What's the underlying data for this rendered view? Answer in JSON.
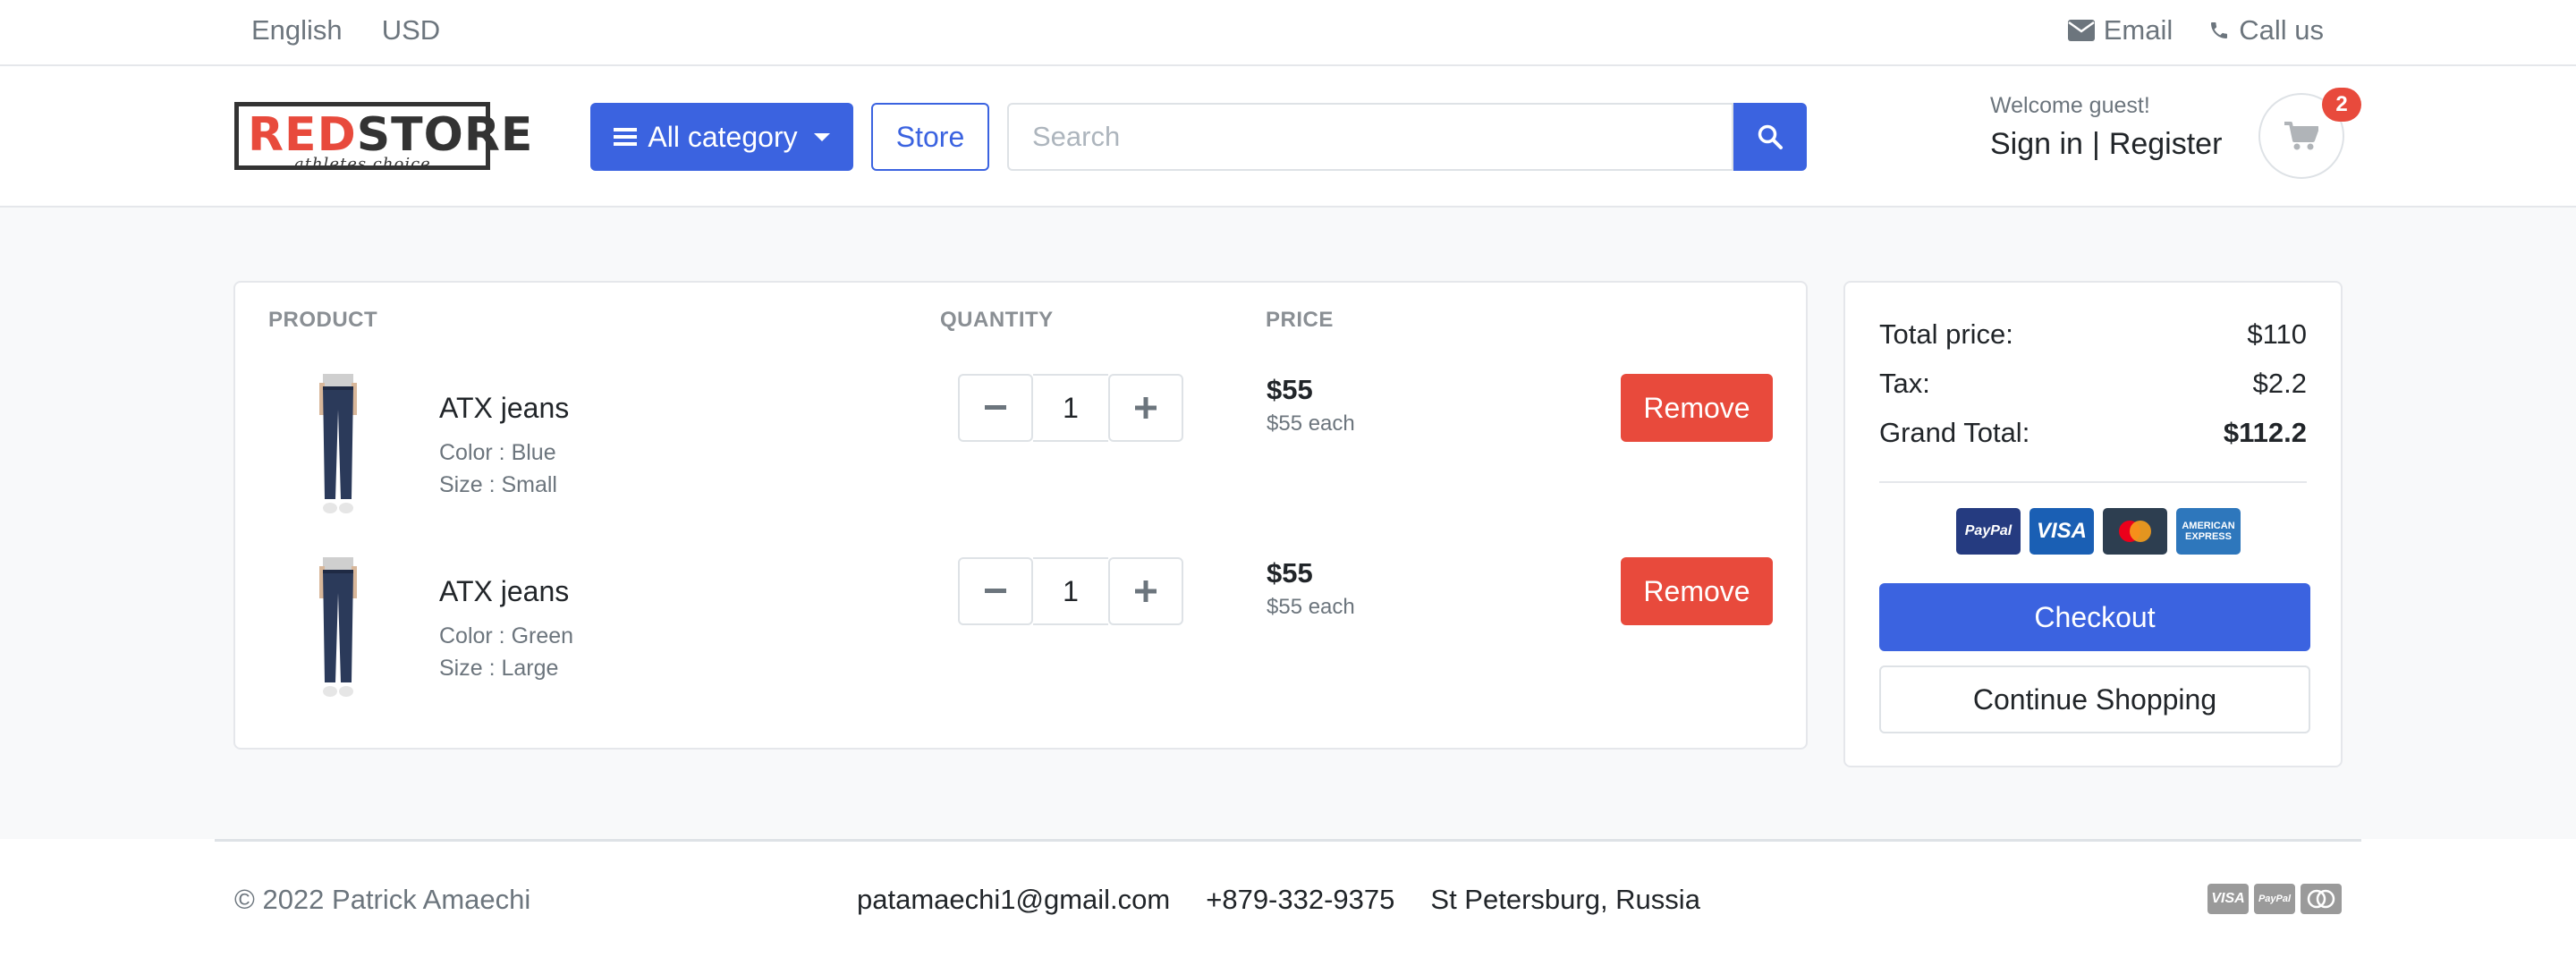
{
  "topbar": {
    "language": "English",
    "currency": "USD",
    "email_label": "Email",
    "call_label": "Call us"
  },
  "header": {
    "logo_part1": "RED",
    "logo_part2": "STORE",
    "logo_tagline": "athletes choice",
    "category_button": "All category",
    "store_button": "Store",
    "search_placeholder": "Search",
    "welcome": "Welcome guest!",
    "sign_in": "Sign in",
    "separator": "|",
    "register": "Register",
    "cart_count": "2"
  },
  "cart": {
    "columns": {
      "product": "PRODUCT",
      "quantity": "QUANTITY",
      "price": "PRICE"
    },
    "items": [
      {
        "name": "ATX jeans",
        "color": "Color : Blue",
        "size": "Size : Small",
        "qty": "1",
        "price": "$55",
        "each": "$55 each",
        "remove": "Remove"
      },
      {
        "name": "ATX jeans",
        "color": "Color : Green",
        "size": "Size : Large",
        "qty": "1",
        "price": "$55",
        "each": "$55 each",
        "remove": "Remove"
      }
    ]
  },
  "summary": {
    "total_label": "Total price:",
    "total_value": "$110",
    "tax_label": "Tax:",
    "tax_value": "$2.2",
    "grand_label": "Grand Total:",
    "grand_value": "$112.2",
    "payment_icons": [
      "PayPal",
      "VISA",
      "mastercard",
      "AMERICAN EXPRESS"
    ],
    "checkout": "Checkout",
    "continue": "Continue Shopping"
  },
  "footer": {
    "copyright": "© 2022 Patrick Amaechi",
    "email": "patamaechi1@gmail.com",
    "phone": "+879-332-9375",
    "location": "St Petersburg, Russia",
    "payment_icons": [
      "VISA",
      "PayPal",
      "mastercard"
    ]
  },
  "colors": {
    "primary": "#3b63e0",
    "danger": "#e84a3c",
    "muted": "#6c757d"
  }
}
